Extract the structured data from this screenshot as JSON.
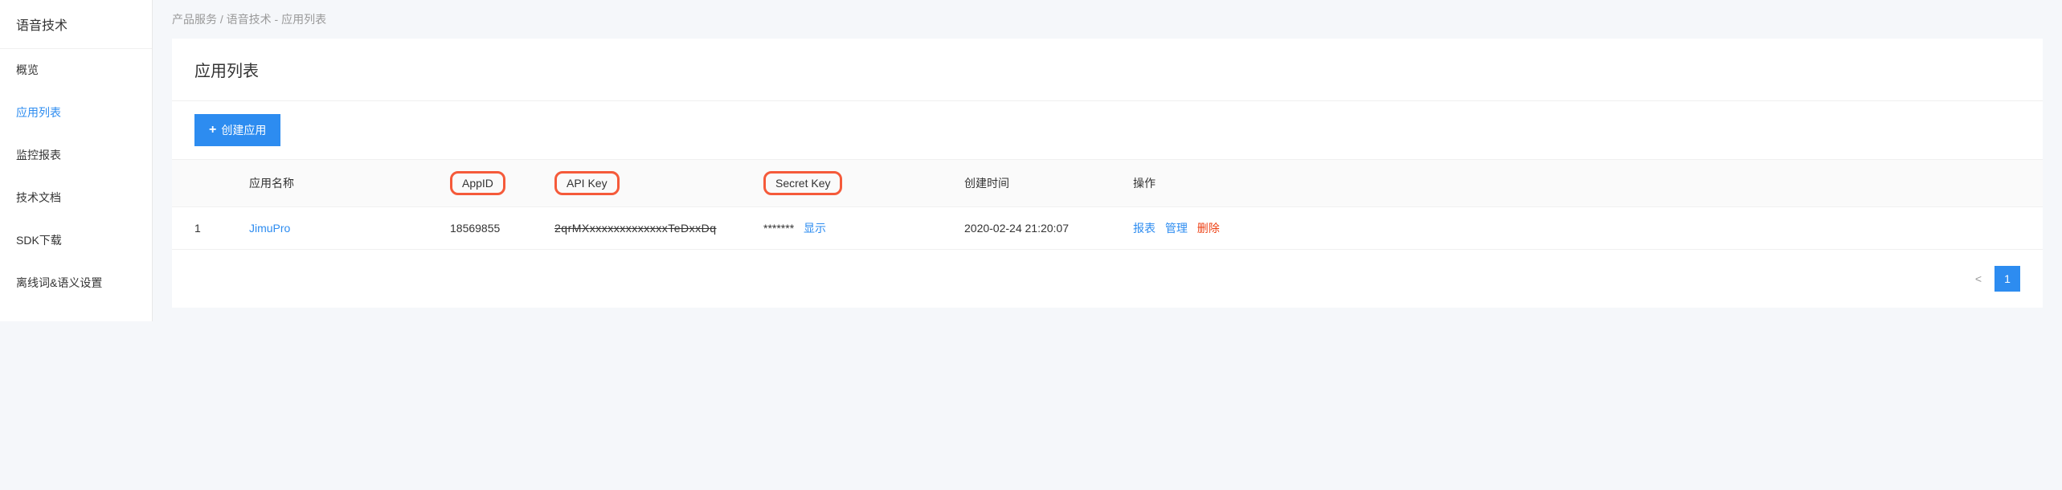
{
  "sidebar": {
    "title": "语音技术",
    "items": [
      {
        "label": "概览",
        "active": false
      },
      {
        "label": "应用列表",
        "active": true
      },
      {
        "label": "监控报表",
        "active": false
      },
      {
        "label": "技术文档",
        "active": false
      },
      {
        "label": "SDK下载",
        "active": false
      },
      {
        "label": "离线词&语义设置",
        "active": false
      }
    ]
  },
  "breadcrumb": {
    "root": "产品服务",
    "sep": "/",
    "current": "语音技术 - 应用列表"
  },
  "panel": {
    "title": "应用列表"
  },
  "toolbar": {
    "create_label": "创建应用"
  },
  "table": {
    "headers": {
      "name": "应用名称",
      "appid": "AppID",
      "apikey": "API Key",
      "secretkey": "Secret Key",
      "time": "创建时间",
      "actions": "操作"
    },
    "rows": [
      {
        "index": "1",
        "name": "JimuPro",
        "appid": "18569855",
        "apikey": "2qrMXxxxxxxxxxxxxxTeDxxDq",
        "secretkey": "*******",
        "show_label": "显示",
        "time": "2020-02-24 21:20:07",
        "action_report": "报表",
        "action_manage": "管理",
        "action_delete": "删除"
      }
    ]
  },
  "pagination": {
    "prev": "<",
    "current": "1"
  }
}
